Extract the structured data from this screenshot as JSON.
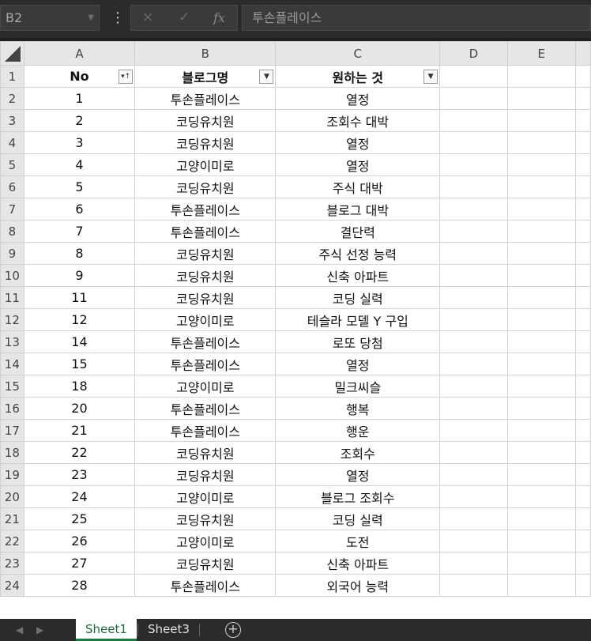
{
  "formula_bar": {
    "name_box": "B2",
    "cancel_icon": "×",
    "enter_icon": "✓",
    "fx_label": "fx",
    "content": "투손플레이스"
  },
  "columns": [
    "A",
    "B",
    "C",
    "D",
    "E"
  ],
  "header_row": {
    "number": "1",
    "a": "No",
    "b": "블로그명",
    "c": "원하는 것"
  },
  "rows": [
    {
      "r": "2",
      "a": "1",
      "b": "투손플레이스",
      "c": "열정"
    },
    {
      "r": "3",
      "a": "2",
      "b": "코딩유치원",
      "c": "조회수 대박"
    },
    {
      "r": "4",
      "a": "3",
      "b": "코딩유치원",
      "c": "열정"
    },
    {
      "r": "5",
      "a": "4",
      "b": "고양이미로",
      "c": "열정"
    },
    {
      "r": "6",
      "a": "5",
      "b": "코딩유치원",
      "c": "주식 대박"
    },
    {
      "r": "7",
      "a": "6",
      "b": "투손플레이스",
      "c": "블로그 대박"
    },
    {
      "r": "8",
      "a": "7",
      "b": "투손플레이스",
      "c": "결단력"
    },
    {
      "r": "9",
      "a": "8",
      "b": "코딩유치원",
      "c": "주식 선정 능력"
    },
    {
      "r": "10",
      "a": "9",
      "b": "코딩유치원",
      "c": "신축 아파트"
    },
    {
      "r": "11",
      "a": "11",
      "b": "코딩유치원",
      "c": "코딩 실력"
    },
    {
      "r": "12",
      "a": "12",
      "b": "고양이미로",
      "c": "테슬라 모델 Y 구입"
    },
    {
      "r": "13",
      "a": "14",
      "b": "투손플레이스",
      "c": "로또 당첨"
    },
    {
      "r": "14",
      "a": "15",
      "b": "투손플레이스",
      "c": "열정"
    },
    {
      "r": "15",
      "a": "18",
      "b": "고양이미로",
      "c": "밀크씨슬"
    },
    {
      "r": "16",
      "a": "20",
      "b": "투손플레이스",
      "c": "행복"
    },
    {
      "r": "17",
      "a": "21",
      "b": "투손플레이스",
      "c": "행운"
    },
    {
      "r": "18",
      "a": "22",
      "b": "코딩유치원",
      "c": "조회수"
    },
    {
      "r": "19",
      "a": "23",
      "b": "코딩유치원",
      "c": "열정"
    },
    {
      "r": "20",
      "a": "24",
      "b": "고양이미로",
      "c": "블로그 조회수"
    },
    {
      "r": "21",
      "a": "25",
      "b": "코딩유치원",
      "c": "코딩 실력"
    },
    {
      "r": "22",
      "a": "26",
      "b": "고양이미로",
      "c": "도전"
    },
    {
      "r": "23",
      "a": "27",
      "b": "코딩유치원",
      "c": "신축 아파트"
    },
    {
      "r": "24",
      "a": "28",
      "b": "투손플레이스",
      "c": "외국어 능력"
    }
  ],
  "sheet_tabs": [
    "Sheet1",
    "Sheet3"
  ],
  "active_sheet": "Sheet1",
  "add_sheet_icon": "+",
  "colors": {
    "accent": "#1c7a40",
    "header_bg": "#e6e6e6",
    "chrome_bg": "#2b2b2b"
  }
}
